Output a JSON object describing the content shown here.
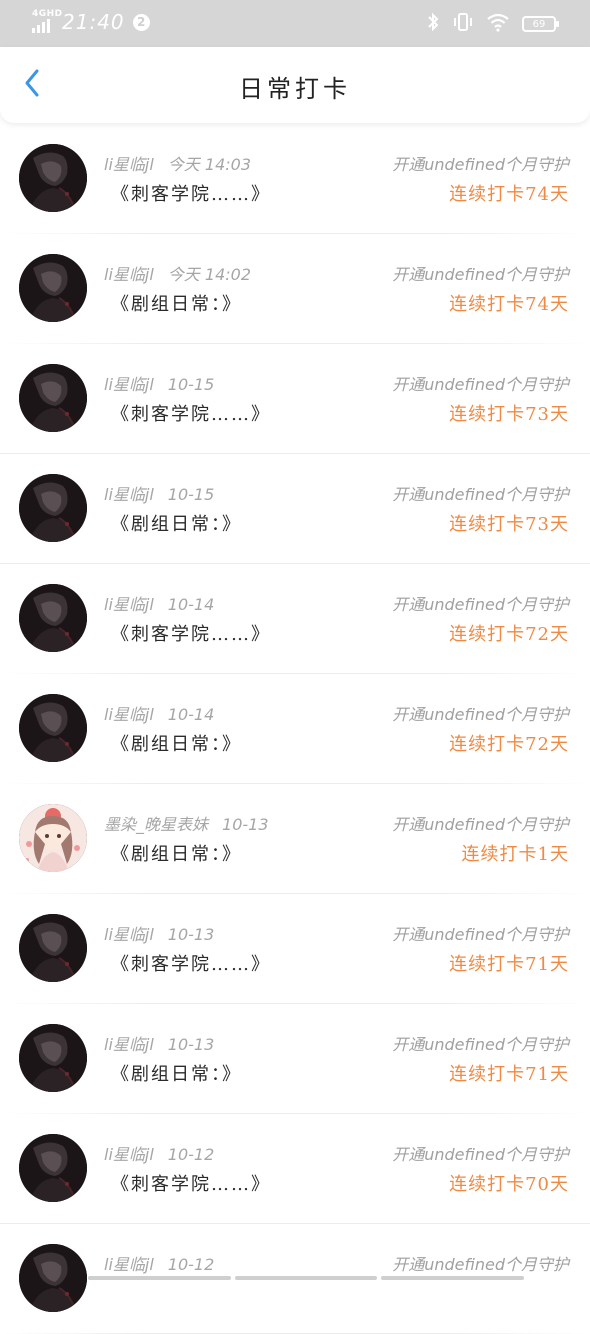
{
  "status_bar": {
    "network": "4GHD",
    "time": "21:40",
    "notification_count": "2",
    "battery": "69"
  },
  "header": {
    "title": "日常打卡"
  },
  "colors": {
    "accent_orange": "#ef8a44",
    "back_blue": "#3a96e6"
  },
  "rows": [
    {
      "user": "li星临jl",
      "time": "今天 14:03",
      "book": "《刺客学院……》",
      "guard": "开通undefined个月守护",
      "streak": "连续打卡74天",
      "avatar": "dark-avatar"
    },
    {
      "user": "li星临jl",
      "time": "今天 14:02",
      "book": "《剧组日常：》",
      "guard": "开通undefined个月守护",
      "streak": "连续打卡74天",
      "avatar": "dark-avatar"
    },
    {
      "user": "li星临jl",
      "time": "10-15",
      "book": "《刺客学院……》",
      "guard": "开通undefined个月守护",
      "streak": "连续打卡73天",
      "avatar": "dark-avatar"
    },
    {
      "user": "li星临jl",
      "time": "10-15",
      "book": "《剧组日常：》",
      "guard": "开通undefined个月守护",
      "streak": "连续打卡73天",
      "avatar": "dark-avatar"
    },
    {
      "user": "li星临jl",
      "time": "10-14",
      "book": "《刺客学院……》",
      "guard": "开通undefined个月守护",
      "streak": "连续打卡72天",
      "avatar": "dark-avatar"
    },
    {
      "user": "li星临jl",
      "time": "10-14",
      "book": "《剧组日常：》",
      "guard": "开通undefined个月守护",
      "streak": "连续打卡72天",
      "avatar": "dark-avatar"
    },
    {
      "user": "墨染_晚星表妹",
      "time": "10-13",
      "book": "《剧组日常：》",
      "guard": "开通undefined个月守护",
      "streak": "连续打卡1天",
      "avatar": "pink-avatar"
    },
    {
      "user": "li星临jl",
      "time": "10-13",
      "book": "《刺客学院……》",
      "guard": "开通undefined个月守护",
      "streak": "连续打卡71天",
      "avatar": "dark-avatar"
    },
    {
      "user": "li星临jl",
      "time": "10-13",
      "book": "《剧组日常：》",
      "guard": "开通undefined个月守护",
      "streak": "连续打卡71天",
      "avatar": "dark-avatar"
    },
    {
      "user": "li星临jl",
      "time": "10-12",
      "book": "《刺客学院……》",
      "guard": "开通undefined个月守护",
      "streak": "连续打卡70天",
      "avatar": "dark-avatar"
    },
    {
      "user": "li星临jl",
      "time": "10-12",
      "book": "",
      "guard": "开通undefined个月守护",
      "streak": "",
      "avatar": "dark-avatar"
    }
  ]
}
